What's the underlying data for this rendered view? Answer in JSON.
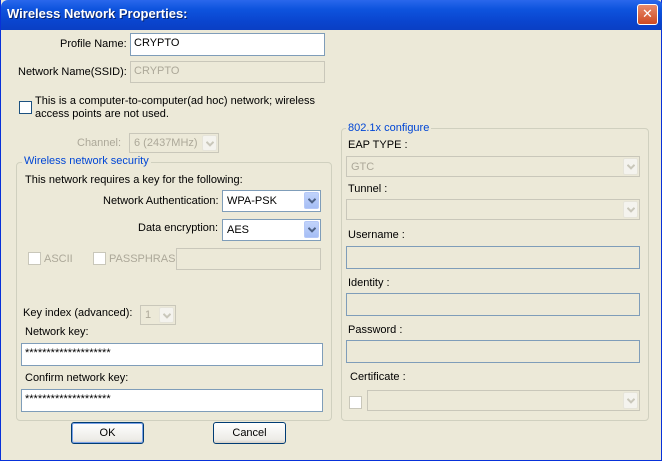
{
  "window": {
    "title": "Wireless Network Properties:",
    "close_glyph": "✕"
  },
  "profile_name": {
    "label": "Profile Name:",
    "value": "CRYPTO"
  },
  "ssid": {
    "label": "Network Name(SSID):",
    "value": "CRYPTO"
  },
  "adhoc": {
    "label_line1": "This is a computer-to-computer(ad hoc) network; wireless",
    "label_line2": "access points are not used.",
    "checked": false
  },
  "channel": {
    "label": "Channel:",
    "value": "6  (2437MHz)"
  },
  "security": {
    "legend": "Wireless network security",
    "requires_text": "This network requires a key for the following:",
    "auth_label": "Network Authentication:",
    "auth_value": "WPA-PSK",
    "enc_label": "Data encryption:",
    "enc_value": "AES",
    "ascii_label": "ASCII",
    "passphrase_label": "PASSPHRASE",
    "key_index_label": "Key index (advanced):",
    "key_index_value": "1",
    "network_key_label": "Network key:",
    "network_key_value": "********************",
    "confirm_key_label": "Confirm network key:",
    "confirm_key_value": "********************"
  },
  "eap": {
    "legend": "802.1x configure",
    "eap_type_label": "EAP TYPE :",
    "eap_type_value": "GTC",
    "tunnel_label": "Tunnel :",
    "tunnel_value": "",
    "username_label": "Username :",
    "identity_label": "Identity :",
    "password_label": "Password :",
    "certificate_label": "Certificate :"
  },
  "buttons": {
    "ok": "OK",
    "cancel": "Cancel"
  }
}
